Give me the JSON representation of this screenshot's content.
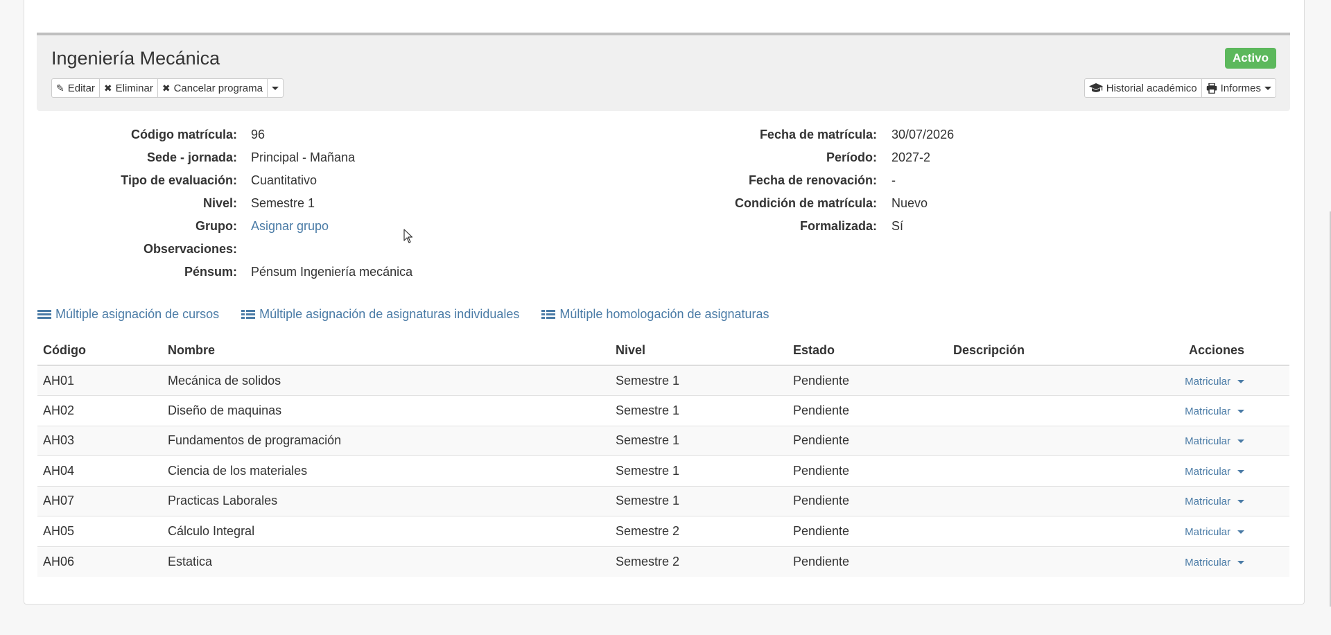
{
  "program": {
    "title": "Ingeniería Mecánica",
    "status": "Activo",
    "buttons_left": [
      {
        "label": "Editar",
        "icon": "pencil-icon",
        "glyph": "✎"
      },
      {
        "label": "Eliminar",
        "icon": "close-icon",
        "glyph": "✖"
      },
      {
        "label": "Cancelar programa",
        "icon": "close-icon",
        "glyph": "✖"
      }
    ],
    "historial_label": "Historial académico",
    "informes_label": "Informes"
  },
  "info_left": [
    {
      "label": "Código matrícula:",
      "value": "96"
    },
    {
      "label": "Sede - jornada:",
      "value": "Principal - Mañana"
    },
    {
      "label": "Tipo de evaluación:",
      "value": "Cuantitativo"
    },
    {
      "label": "Nivel:",
      "value": "Semestre 1"
    },
    {
      "label": "Grupo:",
      "value": "Asignar grupo",
      "link": true
    },
    {
      "label": "Observaciones:",
      "value": ""
    },
    {
      "label": "Pénsum:",
      "value": "Pénsum Ingeniería mecánica"
    }
  ],
  "info_right": [
    {
      "label": "Fecha de matrícula:",
      "value": "30/07/2026"
    },
    {
      "label": "Período:",
      "value": "2027-2"
    },
    {
      "label": "Fecha de renovación:",
      "value": "-"
    },
    {
      "label": "Condición de matrícula:",
      "value": "Nuevo"
    },
    {
      "label": "Formalizada:",
      "value": "Sí"
    }
  ],
  "bulk_links": [
    "Múltiple asignación de cursos",
    "Múltiple asignación de asignaturas individuales",
    "Múltiple homologación de asignaturas"
  ],
  "table": {
    "headers": [
      "Código",
      "Nombre",
      "Nivel",
      "Estado",
      "Descripción",
      "Acciones"
    ],
    "rows": [
      {
        "codigo": "AH01",
        "nombre": "Mecánica de solidos",
        "nivel": "Semestre 1",
        "estado": "Pendiente",
        "descripcion": "",
        "accion": "Matricular"
      },
      {
        "codigo": "AH02",
        "nombre": "Diseño de maquinas",
        "nivel": "Semestre 1",
        "estado": "Pendiente",
        "descripcion": "",
        "accion": "Matricular"
      },
      {
        "codigo": "AH03",
        "nombre": "Fundamentos de programación",
        "nivel": "Semestre 1",
        "estado": "Pendiente",
        "descripcion": "",
        "accion": "Matricular"
      },
      {
        "codigo": "AH04",
        "nombre": "Ciencia de los materiales",
        "nivel": "Semestre 1",
        "estado": "Pendiente",
        "descripcion": "",
        "accion": "Matricular"
      },
      {
        "codigo": "AH07",
        "nombre": "Practicas Laborales",
        "nivel": "Semestre 1",
        "estado": "Pendiente",
        "descripcion": "",
        "accion": "Matricular"
      },
      {
        "codigo": "AH05",
        "nombre": "Cálculo Integral",
        "nivel": "Semestre 2",
        "estado": "Pendiente",
        "descripcion": "",
        "accion": "Matricular"
      },
      {
        "codigo": "AH06",
        "nombre": "Estatica",
        "nivel": "Semestre 2",
        "estado": "Pendiente",
        "descripcion": "",
        "accion": "Matricular"
      }
    ]
  },
  "colors": {
    "accent_tab": "#f07c2a",
    "status_green": "#5cb85c",
    "link_blue": "#4a7ba6"
  }
}
